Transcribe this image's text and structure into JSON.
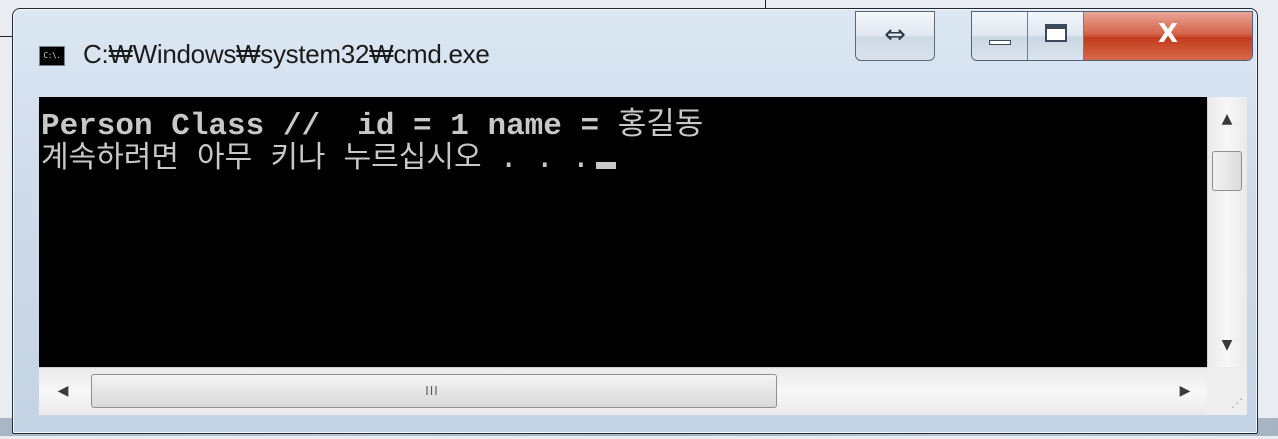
{
  "window": {
    "title": "C:₩Windows₩system32₩cmd.exe",
    "icon_label": "C:\\.",
    "snap_glyph": "⇔",
    "close_glyph": "X"
  },
  "console": {
    "line1_prefix": "Person Class //  id = 1 name = ",
    "line1_name": "홍길동",
    "line2": "계속하려면 아무 키나 누르십시오 . . ."
  },
  "scrollbar": {
    "up_arrow": "▲",
    "down_arrow": "▼",
    "left_arrow": "◀",
    "right_arrow": "▶",
    "grip": "III"
  },
  "colors": {
    "console_bg": "#000000",
    "console_text": "#c8c8c8",
    "close_button": "#c8442a"
  }
}
